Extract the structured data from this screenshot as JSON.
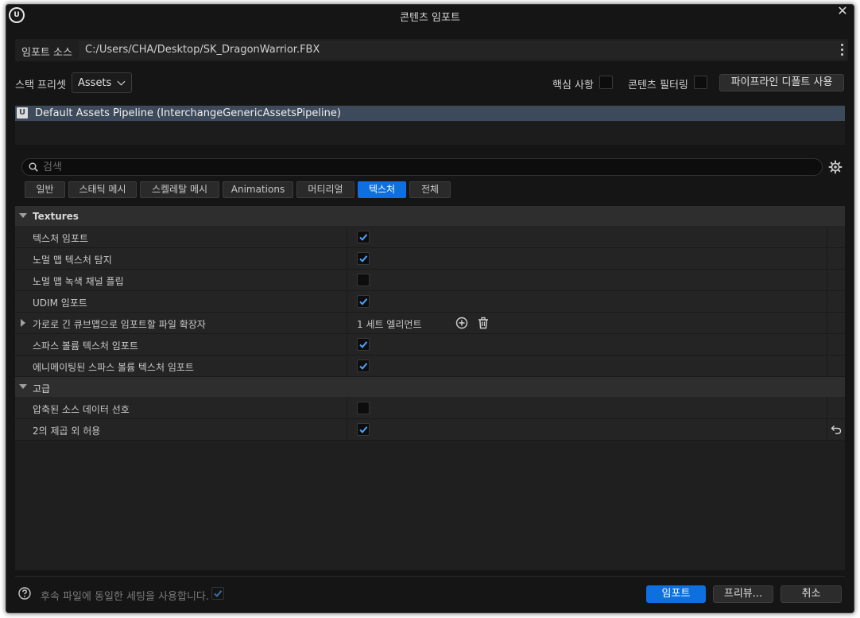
{
  "window": {
    "title": "콘텐츠 임포트",
    "logo_text": "U"
  },
  "source": {
    "label": "임포트 소스",
    "path": "C:/Users/CHA/Desktop/SK_DragonWarrior.FBX"
  },
  "preset": {
    "label": "스택 프리셋",
    "value": "Assets"
  },
  "options": {
    "core_label": "핵심 사항",
    "filter_label": "콘텐츠 필터링",
    "reset_button": "파이프라인 디폴트 사용"
  },
  "pipeline": {
    "icon_text": "U",
    "name": "Default Assets Pipeline (InterchangeGenericAssetsPipeline)"
  },
  "search": {
    "placeholder": "검색"
  },
  "tabs": [
    {
      "label": "일반",
      "active": false
    },
    {
      "label": "스태틱 메시",
      "active": false
    },
    {
      "label": "스켈레탈 메시",
      "active": false
    },
    {
      "label": "Animations",
      "active": false
    },
    {
      "label": "머티리얼",
      "active": false
    },
    {
      "label": "텍스처",
      "active": true
    },
    {
      "label": "전체",
      "active": false
    }
  ],
  "categories": {
    "textures": {
      "label": "Textures",
      "props": [
        {
          "name": "텍스처 임포트",
          "checked": true
        },
        {
          "name": "노멀 맵 텍스처 탐지",
          "checked": true
        },
        {
          "name": "노멀 맵 녹색 채널 플립",
          "checked": false
        },
        {
          "name": "UDIM 임포트",
          "checked": true
        },
        {
          "name": "가로로 긴 큐브맵으로 임포트할 파일 확장자",
          "array": "1 세트 엘리먼트"
        },
        {
          "name": "스파스 볼륨 텍스처 임포트",
          "checked": true
        },
        {
          "name": "에니메이팅된 스파스 볼륨 텍스처 임포트",
          "checked": true
        }
      ]
    },
    "advanced": {
      "label": "고급",
      "props": [
        {
          "name": "압축된 소스 데이터 선호",
          "checked": false
        },
        {
          "name": "2의 제곱 외 허용",
          "checked": true
        }
      ]
    }
  },
  "footer": {
    "help_text": "후속 파일에 동일한 세팅을 사용합니다.",
    "import_button": "임포트",
    "preview_button": "프리뷰...",
    "cancel_button": "취소"
  },
  "colors": {
    "accent": "#0e6fe0",
    "background": "#151515",
    "selection": "#3d4a5b"
  }
}
